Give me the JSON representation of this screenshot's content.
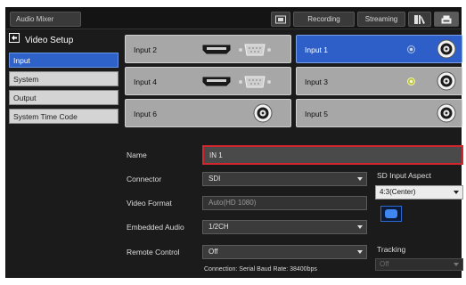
{
  "topbar": {
    "app_tab": "Audio Mixer",
    "monitor_icon": "monitor-icon",
    "recording": "Recording",
    "streaming": "Streaming",
    "media_icon": "media-icon",
    "settings_icon": "settings-icon"
  },
  "sidebar": {
    "title": "Video Setup",
    "title_icon": "back-arrow-icon",
    "items": [
      {
        "label": "Input",
        "active": true
      },
      {
        "label": "System",
        "active": false
      },
      {
        "label": "Output",
        "active": false
      },
      {
        "label": "System Time Code",
        "active": false
      }
    ]
  },
  "inputs": [
    {
      "label": "Input 2",
      "selected": false,
      "connectors": [
        "hdmi-icon",
        "dsub-icon"
      ]
    },
    {
      "label": "Input 1",
      "selected": true,
      "connectors": [
        "status-led-icon",
        "bnc-icon"
      ]
    },
    {
      "label": "Input 4",
      "selected": false,
      "connectors": [
        "hdmi-icon",
        "dsub-icon"
      ]
    },
    {
      "label": "Input 3",
      "selected": false,
      "connectors": [
        "status-led-icon",
        "bnc-icon"
      ]
    },
    {
      "label": "Input 6",
      "selected": false,
      "connectors": [
        "bnc-icon"
      ]
    },
    {
      "label": "Input 5",
      "selected": false,
      "connectors": [
        "bnc-icon"
      ]
    }
  ],
  "form": {
    "name_label": "Name",
    "name_value": "IN 1",
    "connector_label": "Connector",
    "connector_value": "SDI",
    "video_format_label": "Video Format",
    "video_format_value": "Auto(HD 1080)",
    "embedded_audio_label": "Embedded Audio",
    "embedded_audio_value": "1/2CH",
    "remote_control_label": "Remote Control",
    "remote_control_value": "Off",
    "sd_aspect_label": "SD Input Aspect",
    "sd_aspect_value": "4:3(Center)",
    "tracking_label": "Tracking",
    "tracking_value": "Off",
    "connection_info": "Connection: Serial   Baud Rate: 38400bps"
  },
  "colors": {
    "accent_blue": "#2e5fc9",
    "name_highlight": "#d1262d",
    "led_green": "#e8f0a0"
  }
}
